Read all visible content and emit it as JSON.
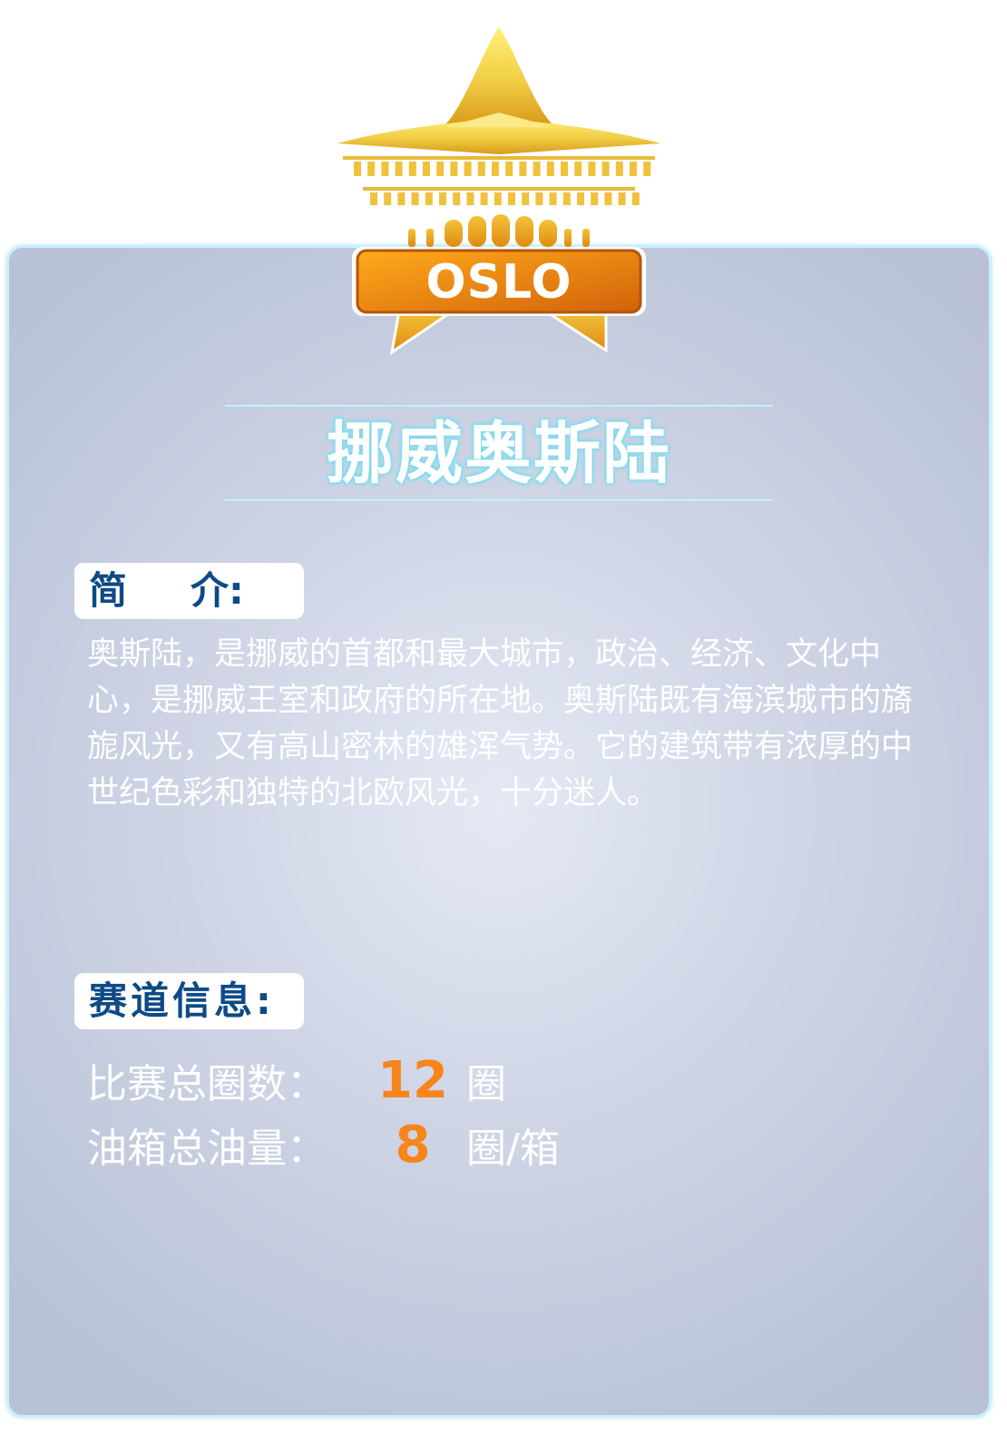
{
  "city_tag": "OSLO",
  "city_title": "挪威奥斯陆",
  "intro": {
    "label_left": "简",
    "label_right": "介:",
    "text": "奥斯陆，是挪威的首都和最大城市，政治、经济、文化中心，是挪威王室和政府的所在地。奥斯陆既有海滨城市的旖旎风光，又有高山密林的雄浑气势。它的建筑带有浓厚的中世纪色彩和独特的北欧风光，十分迷人。"
  },
  "track": {
    "label": "赛道信息:",
    "laps": {
      "label": "比赛总圈数：",
      "value": "12",
      "unit": "圈"
    },
    "fuel": {
      "label": "油箱总油量：",
      "value": "8",
      "unit": "圈/箱"
    }
  },
  "colors": {
    "star_gold": "#f6d84a",
    "tag_orange": "#f08a10",
    "label_blue": "#0d4a86",
    "value_orange": "#f7851c"
  }
}
